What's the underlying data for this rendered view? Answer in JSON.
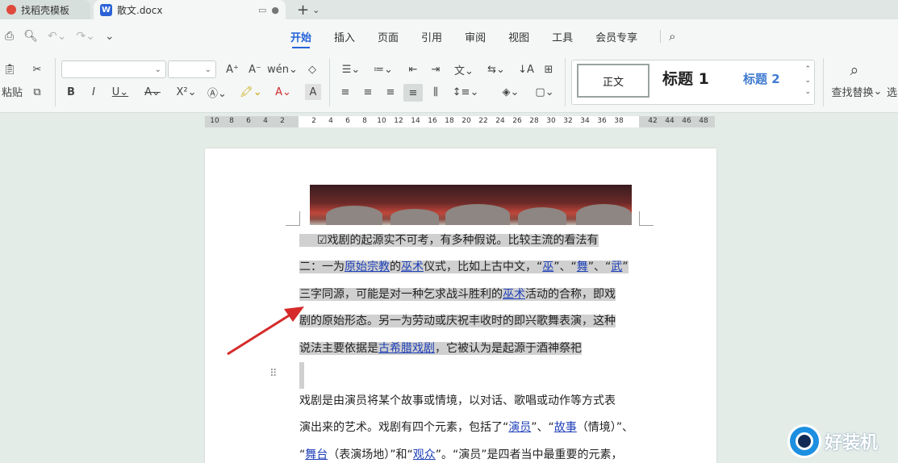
{
  "tabs": [
    {
      "label": "找稻壳模板",
      "icon": "docer-logo-icon",
      "active": false
    },
    {
      "label": "散文.docx",
      "icon": "word-doc-icon",
      "active": true
    }
  ],
  "menu": {
    "tabs": [
      "开始",
      "插入",
      "页面",
      "引用",
      "审阅",
      "视图",
      "工具",
      "会员专享"
    ],
    "active": "开始"
  },
  "ribbon": {
    "paste_label": "粘贴",
    "styles": {
      "normal": "正文",
      "heading1": "标题 1",
      "heading2": "标题 2"
    },
    "find_replace_label": "查找替换",
    "select_label": "选"
  },
  "ruler": {
    "left_ticks": [
      "10",
      "8",
      "6",
      "4",
      "2"
    ],
    "right_ticks": [
      "2",
      "4",
      "6",
      "8",
      "10",
      "12",
      "14",
      "16",
      "18",
      "20",
      "22",
      "24",
      "26",
      "28",
      "30",
      "32",
      "34",
      "36",
      "38",
      "42",
      "44",
      "46",
      "48"
    ]
  },
  "document": {
    "highlighted_lines": [
      "☑戏剧的起源实不可考，有多种假说。比较主流的看法有",
      "二：一为|原始宗教|的|巫术|仪式，比如上古中文，“|巫|”、“|舞|”、“|武|”",
      "三字同源，可能是对一种乞求战斗胜利的|巫术|活动的合称，即戏",
      "剧的原始形态。另一为劳动或庆祝丰收时的即兴歌舞表演，这种",
      "说法主要依据是|古希腊戏剧|，它被认为是起源于酒神祭祀"
    ],
    "body_lines": [
      "戏剧是由演员将某个故事或情境，以对话、歌唱或动作等方式表",
      "演出来的艺术。戏剧有四个元素，包括了“|演员|”、“|故事|（情境）”、",
      "“|舞台|（表演场地）”和“|观众|”。“演员”是四者当中最重要的元素，"
    ]
  },
  "watermark": {
    "text": "好装机"
  },
  "colors": {
    "accent": "#2563d8",
    "link": "#1d3fb8",
    "highlight": "#d0d0d0",
    "arrow": "#d62a2a"
  }
}
